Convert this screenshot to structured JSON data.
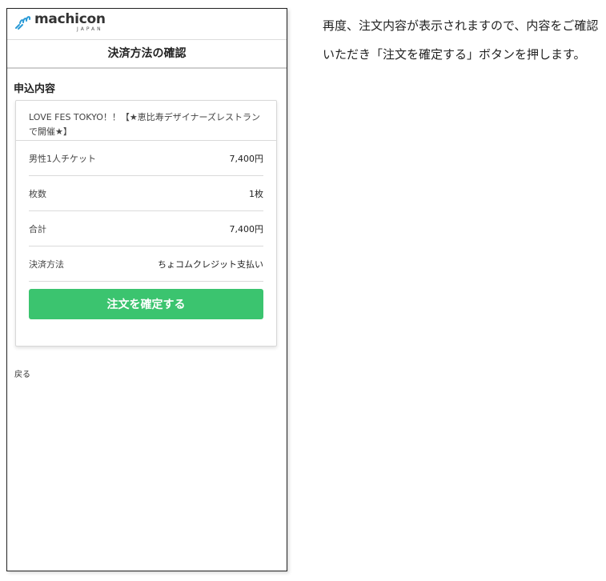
{
  "logo": {
    "name": "machicon",
    "sub": "JAPAN"
  },
  "page_title": "決済方法の確認",
  "section_title": "申込内容",
  "event_name": "LOVE FES TOKYO！！【★恵比寿デザイナーズレストランで開催★】",
  "rows": [
    {
      "label": "男性1人チケット",
      "value": "7,400円"
    },
    {
      "label": "枚数",
      "value": "1枚"
    },
    {
      "label": "合計",
      "value": "7,400円"
    },
    {
      "label": "決済方法",
      "value": "ちょコムクレジット支払い"
    }
  ],
  "confirm_button": "注文を確定する",
  "back_link": "戻る",
  "instructions": "再度、注文内容が表示されますので、内容をご確認いただき「注文を確定する」ボタンを押します。",
  "colors": {
    "accent": "#3bc46f",
    "logo_blue": "#2a9ad6"
  },
  "icons": {
    "logo_mark": "machicon-logo-icon"
  }
}
